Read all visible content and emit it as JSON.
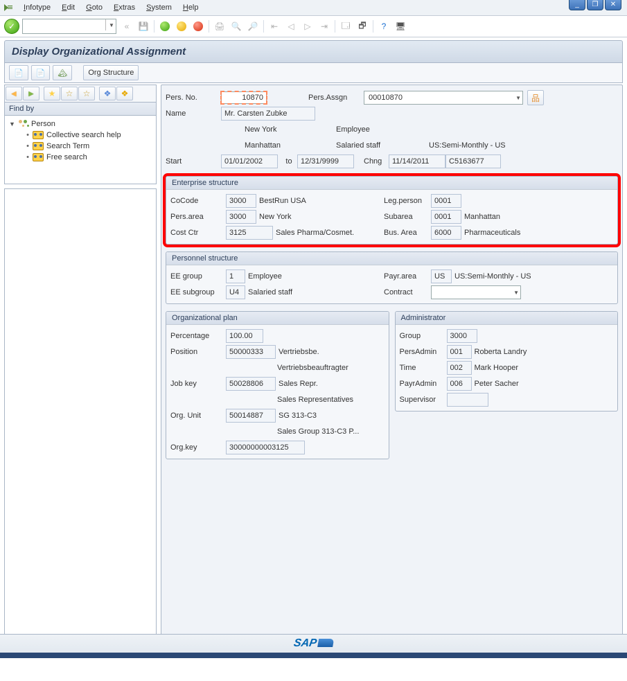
{
  "menu": {
    "items": [
      "Infotype",
      "Edit",
      "Goto",
      "Extras",
      "System",
      "Help"
    ]
  },
  "title": "Display Organizational Assignment",
  "app_toolbar": {
    "org_structure_label": "Org Structure"
  },
  "find_by": {
    "header": "Find by",
    "root": "Person",
    "items": [
      "Collective search help",
      "Search Term",
      "Free search"
    ]
  },
  "header": {
    "pers_no_label": "Pers. No.",
    "pers_no": "10870",
    "pers_assgn_label": "Pers.Assgn",
    "pers_assgn": "00010870",
    "name_label": "Name",
    "name": "Mr. Carsten Zubke",
    "area_text": "New York",
    "emp_text": "Employee",
    "subarea_text": "Manhattan",
    "subgroup_text": "Salaried staff",
    "payr_text": "US:Semi-Monthly - US",
    "start_label": "Start",
    "start": "01/01/2002",
    "to_label": "to",
    "end": "12/31/9999",
    "chng_label": "Chng",
    "chng_date": "11/14/2011",
    "chng_user": "C5163677"
  },
  "enterprise": {
    "title": "Enterprise structure",
    "cocode_label": "CoCode",
    "cocode": "3000",
    "cocode_text": "BestRun USA",
    "legperson_label": "Leg.person",
    "legperson": "0001",
    "persarea_label": "Pers.area",
    "persarea": "3000",
    "persarea_text": "New York",
    "subarea_label": "Subarea",
    "subarea": "0001",
    "subarea_text": "Manhattan",
    "costctr_label": "Cost Ctr",
    "costctr": "3125",
    "costctr_text": "Sales Pharma/Cosmet.",
    "busarea_label": "Bus. Area",
    "busarea": "6000",
    "busarea_text": "Pharmaceuticals"
  },
  "personnel": {
    "title": "Personnel structure",
    "eegroup_label": "EE group",
    "eegroup": "1",
    "eegroup_text": "Employee",
    "payrarea_label": "Payr.area",
    "payrarea": "US",
    "payrarea_text": "US:Semi-Monthly - US",
    "eesub_label": "EE subgroup",
    "eesub": "U4",
    "eesub_text": "Salaried staff",
    "contract_label": "Contract",
    "contract": ""
  },
  "orgplan": {
    "title": "Organizational plan",
    "pct_label": "Percentage",
    "pct": "100.00",
    "pos_label": "Position",
    "pos": "50000333",
    "pos_text1": "Vertriebsbe.",
    "pos_text2": "Vertriebsbeauftragter",
    "job_label": "Job key",
    "job": "50028806",
    "job_text1": "Sales Repr.",
    "job_text2": "Sales Representatives",
    "orgunit_label": "Org. Unit",
    "orgunit": "50014887",
    "orgunit_text1": "SG 313-C3",
    "orgunit_text2": "Sales Group 313-C3 P...",
    "orgkey_label": "Org.key",
    "orgkey": "30000000003125"
  },
  "admin": {
    "title": "Administrator",
    "group_label": "Group",
    "group": "3000",
    "persadmin_label": "PersAdmin",
    "persadmin": "001",
    "persadmin_text": "Roberta Landry",
    "time_label": "Time",
    "time": "002",
    "time_text": "Mark Hooper",
    "payradmin_label": "PayrAdmin",
    "payradmin": "006",
    "payradmin_text": "Peter Sacher",
    "supervisor_label": "Supervisor",
    "supervisor": ""
  },
  "sap_logo": "SAP"
}
